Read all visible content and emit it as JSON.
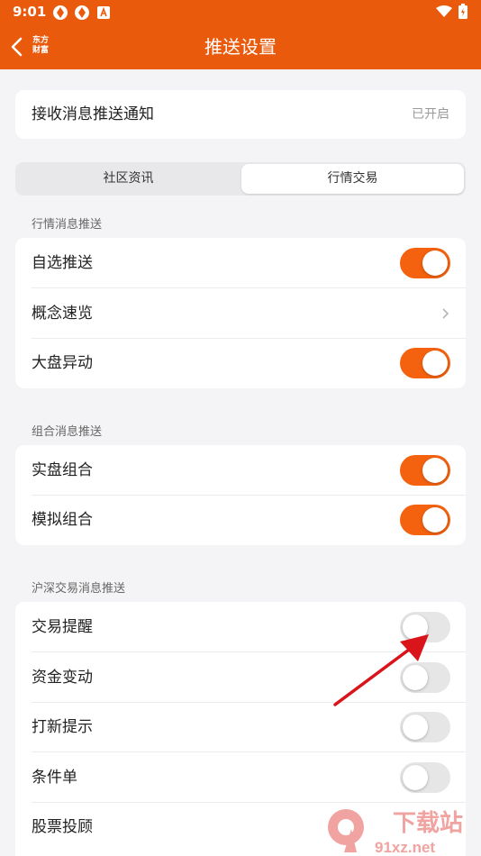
{
  "status_bar": {
    "time": "9:01"
  },
  "header": {
    "brand_line1": "东方",
    "brand_line2": "财富",
    "title": "推送设置"
  },
  "receive_row": {
    "label": "接收消息推送通知",
    "value": "已开启"
  },
  "segment": {
    "tabs": [
      {
        "label": "社区资讯",
        "active": false
      },
      {
        "label": "行情交易",
        "active": true
      }
    ]
  },
  "section_market": {
    "title": "行情消息推送",
    "rows": [
      {
        "label": "自选推送",
        "type": "toggle",
        "on": true
      },
      {
        "label": "概念速览",
        "type": "link"
      },
      {
        "label": "大盘异动",
        "type": "toggle",
        "on": true
      }
    ]
  },
  "section_portfolio": {
    "title": "组合消息推送",
    "rows": [
      {
        "label": "实盘组合",
        "type": "toggle",
        "on": true
      },
      {
        "label": "模拟组合",
        "type": "toggle",
        "on": true
      }
    ]
  },
  "section_trade": {
    "title": "沪深交易消息推送",
    "rows": [
      {
        "label": "交易提醒",
        "type": "toggle",
        "on": false
      },
      {
        "label": "资金变动",
        "type": "toggle",
        "on": false
      },
      {
        "label": "打新提示",
        "type": "toggle",
        "on": false
      },
      {
        "label": "条件单",
        "type": "toggle",
        "on": false
      },
      {
        "label": "股票投顾",
        "type": "none"
      }
    ]
  },
  "watermark": {
    "big_text": "下载站",
    "small_text": "91xz.net"
  },
  "colors": {
    "accent": "#ea5a0c",
    "toggle_on": "#f4620f",
    "toggle_off": "#e6e6e6",
    "arrow": "#d9141b"
  }
}
